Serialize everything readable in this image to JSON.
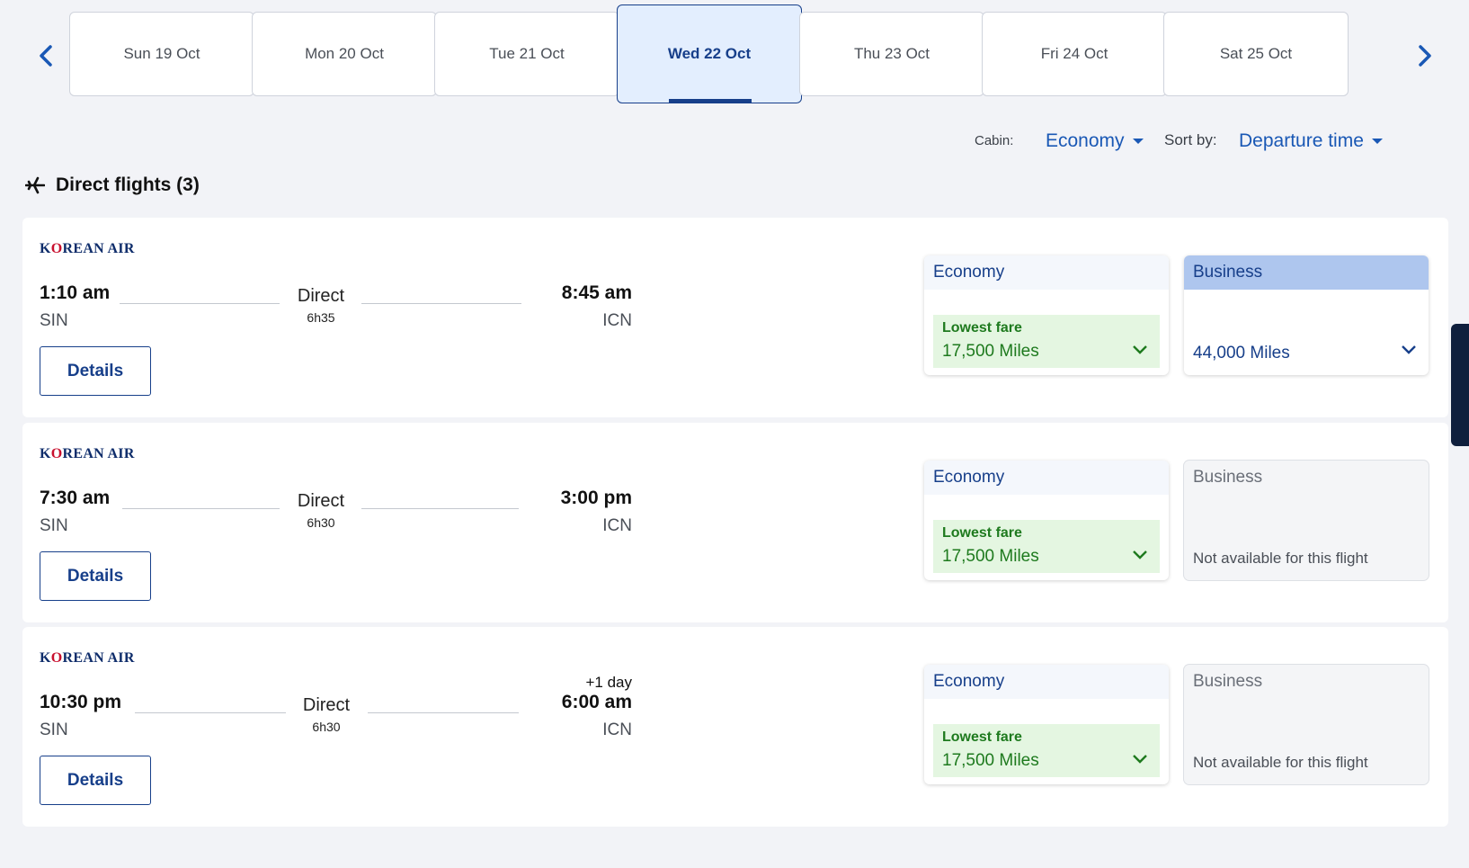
{
  "dates": [
    {
      "label": "Sun 19 Oct",
      "active": false
    },
    {
      "label": "Mon 20 Oct",
      "active": false
    },
    {
      "label": "Tue 21 Oct",
      "active": false
    },
    {
      "label": "Wed 22 Oct",
      "active": true
    },
    {
      "label": "Thu 23 Oct",
      "active": false
    },
    {
      "label": "Fri 24 Oct",
      "active": false
    },
    {
      "label": "Sat 25 Oct",
      "active": false
    }
  ],
  "filters": {
    "cabin_label": "Cabin:",
    "cabin_value": "Economy",
    "sort_label": "Sort by:",
    "sort_value": "Departure time"
  },
  "section": {
    "title": "Direct flights (3)"
  },
  "flights": [
    {
      "airline": "KOREAN AIR",
      "dep_time": "1:10 am",
      "dep_code": "SIN",
      "arr_time": "8:45 am",
      "arr_code": "ICN",
      "plus_day": "",
      "stops": "Direct",
      "duration": "6h35",
      "details_label": "Details",
      "economy": {
        "label": "Economy",
        "tag": "Lowest fare",
        "miles": "17,500 Miles"
      },
      "business": {
        "label": "Business",
        "miles": "44,000 Miles",
        "note": ""
      }
    },
    {
      "airline": "KOREAN AIR",
      "dep_time": "7:30 am",
      "dep_code": "SIN",
      "arr_time": "3:00 pm",
      "arr_code": "ICN",
      "plus_day": "",
      "stops": "Direct",
      "duration": "6h30",
      "details_label": "Details",
      "economy": {
        "label": "Economy",
        "tag": "Lowest fare",
        "miles": "17,500 Miles"
      },
      "business": {
        "label": "Business",
        "miles": "",
        "note": "Not available for this flight"
      }
    },
    {
      "airline": "KOREAN AIR",
      "dep_time": "10:30 pm",
      "dep_code": "SIN",
      "arr_time": "6:00 am",
      "arr_code": "ICN",
      "plus_day": "+1 day",
      "stops": "Direct",
      "duration": "6h30",
      "details_label": "Details",
      "economy": {
        "label": "Economy",
        "tag": "Lowest fare",
        "miles": "17,500 Miles"
      },
      "business": {
        "label": "Business",
        "miles": "",
        "note": "Not available for this flight"
      }
    }
  ],
  "colors": {
    "primary": "#173f8a",
    "link": "#1a58b5",
    "success": "#1e7a1e",
    "success_bg": "#e4f6e1"
  }
}
